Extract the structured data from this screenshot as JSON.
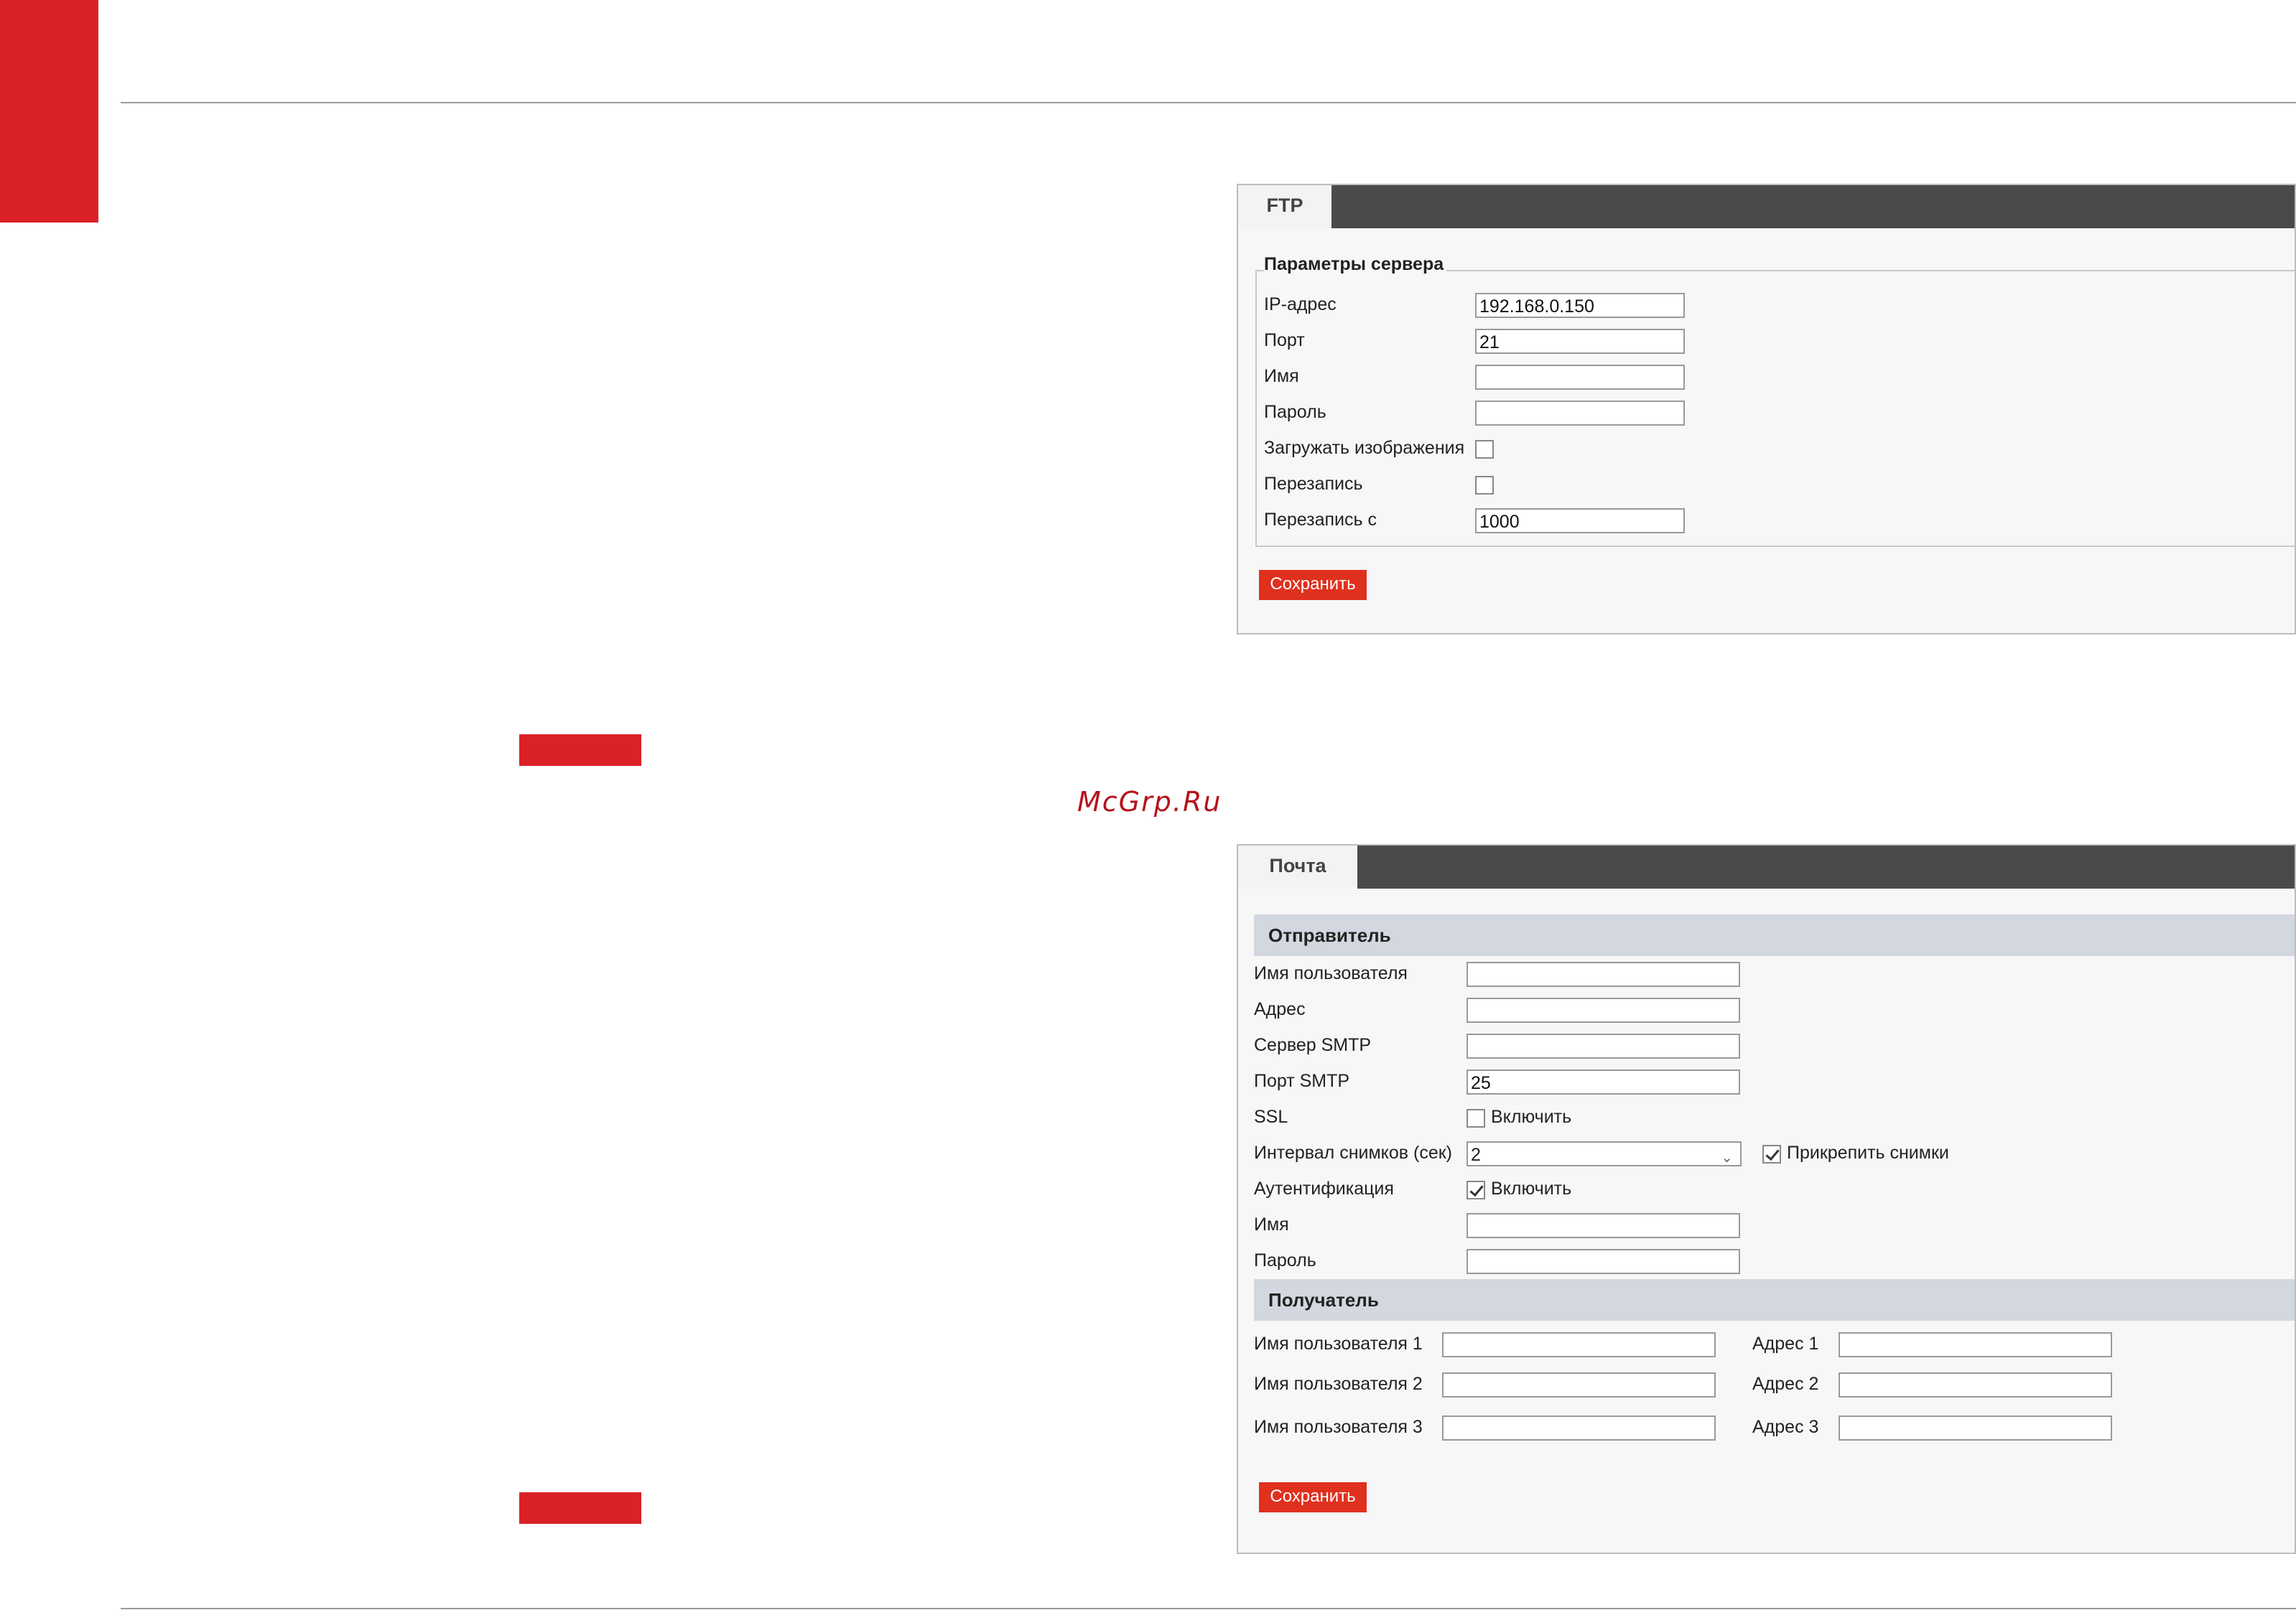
{
  "brand": {
    "watermark": "McGrp.Ru"
  },
  "ftp": {
    "tab_label": "FTP",
    "section_title": "Параметры сервера",
    "fields": {
      "ip_label": "IP-адрес",
      "ip_value": "192.168.0.150",
      "port_label": "Порт",
      "port_value": "21",
      "name_label": "Имя",
      "name_value": "",
      "password_label": "Пароль",
      "password_value": "",
      "upload_label": "Загружать изображения",
      "upload_checked": false,
      "overwrite_label": "Перезапись",
      "overwrite_checked": false,
      "overwrite_from_label": "Перезапись с",
      "overwrite_from_value": "1000"
    },
    "save_label": "Сохранить"
  },
  "mail": {
    "tab_label": "Почта",
    "sender": {
      "title": "Отправитель",
      "username_label": "Имя пользователя",
      "username_value": "",
      "address_label": "Адрес",
      "address_value": "",
      "smtp_server_label": "Сервер SMTP",
      "smtp_server_value": "",
      "smtp_port_label": "Порт SMTP",
      "smtp_port_value": "25",
      "ssl_label": "SSL",
      "ssl_enable_label": "Включить",
      "ssl_checked": false,
      "interval_label": "Интервал снимков (сек)",
      "interval_value": "2",
      "attach_label": "Прикрепить снимки",
      "attach_checked": true,
      "auth_label": "Аутентификация",
      "auth_enable_label": "Включить",
      "auth_checked": true,
      "name_label": "Имя",
      "name_value": "",
      "password_label": "Пароль",
      "password_value": ""
    },
    "recipient": {
      "title": "Получатель",
      "rows": [
        {
          "user_label": "Имя пользователя 1",
          "user_value": "",
          "addr_label": "Адрес 1",
          "addr_value": ""
        },
        {
          "user_label": "Имя пользователя 2",
          "user_value": "",
          "addr_label": "Адрес 2",
          "addr_value": ""
        },
        {
          "user_label": "Имя пользователя 3",
          "user_value": "",
          "addr_label": "Адрес 3",
          "addr_value": ""
        }
      ]
    },
    "save_label": "Сохранить"
  }
}
